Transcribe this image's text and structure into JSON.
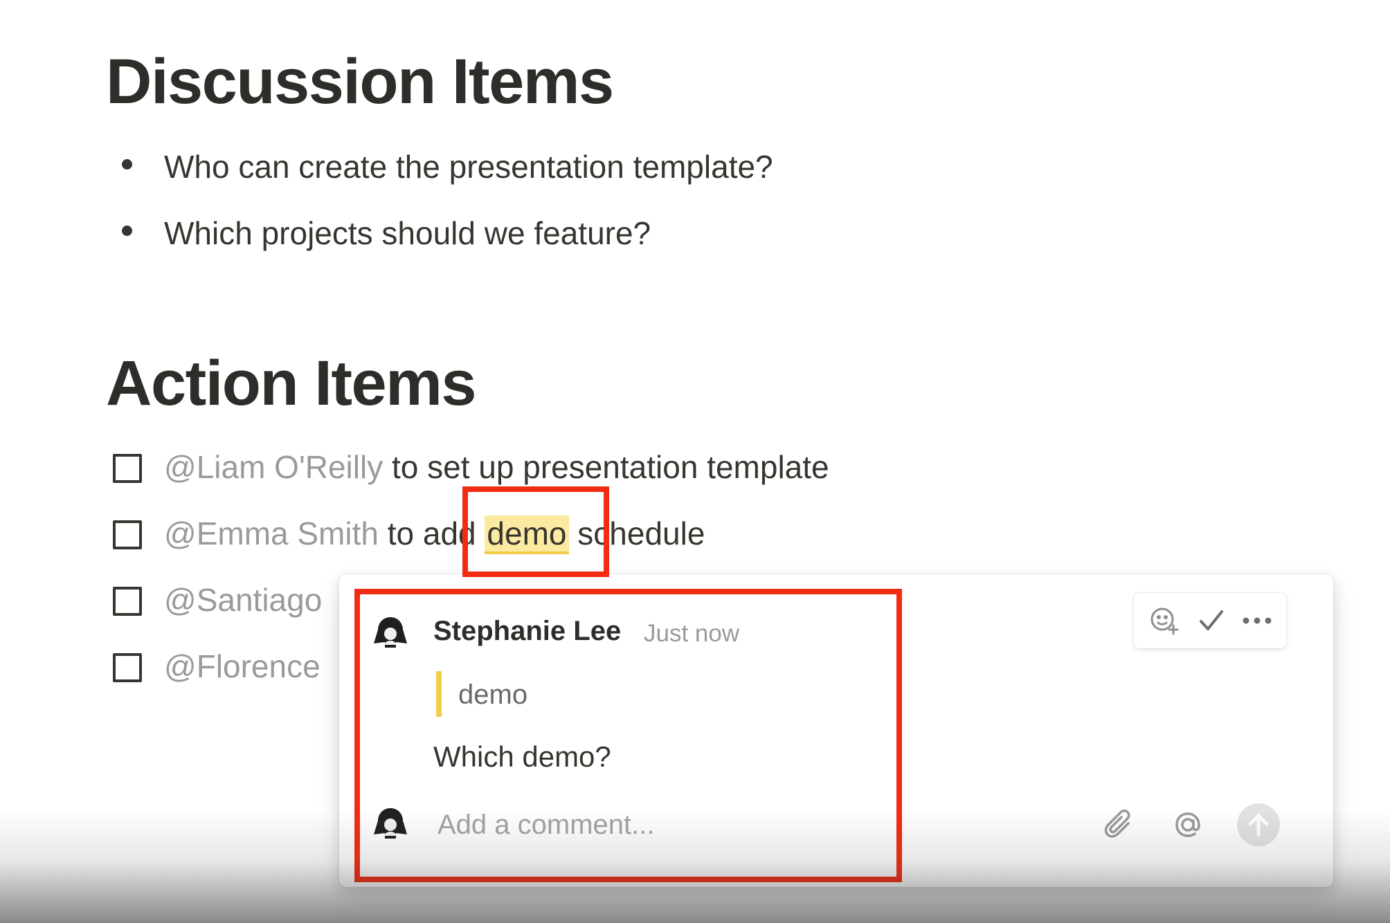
{
  "discussion": {
    "heading": "Discussion Items",
    "bullets": [
      "Who can create the presentation template?",
      "Which projects should we feature?"
    ]
  },
  "actions": {
    "heading": "Action Items",
    "items": [
      {
        "mention": "@Liam O'Reilly",
        "text": " to set up presentation template"
      },
      {
        "mention": "@Emma Smith",
        "text_before": " to add ",
        "highlight": "demo",
        "text_after": " schedule"
      },
      {
        "mention": "@Santiago"
      },
      {
        "mention": "@Florence"
      }
    ]
  },
  "comment": {
    "author": "Stephanie Lee",
    "time": "Just now",
    "quote": "demo",
    "body": "Which demo?",
    "input_placeholder": "Add a comment..."
  },
  "toolbar": {
    "icons": [
      "add-reaction-icon",
      "resolve-check-icon",
      "more-options-icon"
    ]
  },
  "footer": {
    "icons": [
      "attachment-icon",
      "mention-icon",
      "send-arrow-icon"
    ]
  },
  "colors": {
    "highlight": "#fbeaa0",
    "highlight_underline": "#f2cc4a",
    "annotation": "#f22c12",
    "mention": "#9b9a97"
  }
}
